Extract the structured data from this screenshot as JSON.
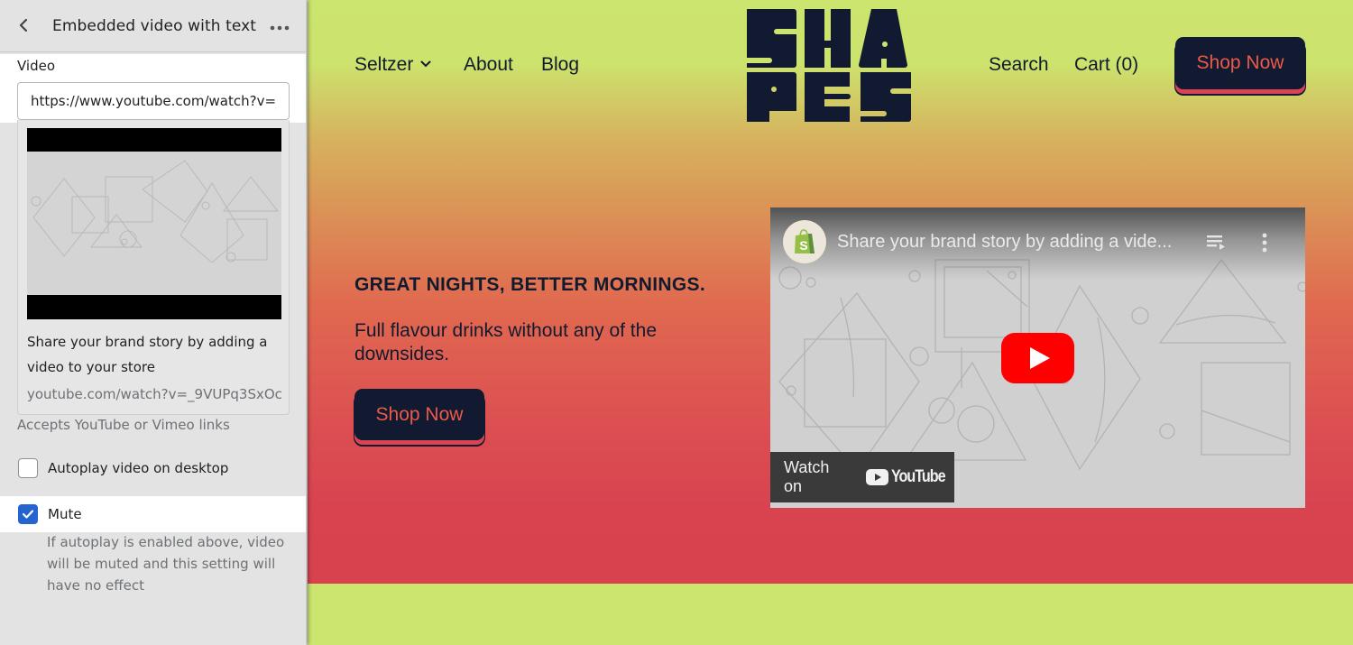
{
  "sidebar": {
    "title": "Embedded video with text",
    "back_icon": "chevron-left-icon",
    "more_icon": "ellipsis-icon",
    "video_field": {
      "label": "Video",
      "value": "https://www.youtube.com/watch?v=_9VUPq3SxOc",
      "display_value": "https://www.youtube.com/watch?v=_"
    },
    "preview": {
      "description": "Share your brand story by adding a video to your store",
      "url": "youtube.com/watch?v=_9VUPq3SxOc"
    },
    "help_text": "Accepts YouTube or Vimeo links",
    "autoplay": {
      "label": "Autoplay video on desktop",
      "checked": false
    },
    "mute": {
      "label": "Mute",
      "checked": true,
      "help": "If autoplay is enabled above, video will be muted and this setting will have no effect"
    }
  },
  "store": {
    "logo_text": "SHAPES",
    "nav": {
      "seltzer": "Seltzer",
      "about": "About",
      "blog": "Blog",
      "search": "Search",
      "cart": "Cart (0)"
    },
    "header_cta": "Shop Now",
    "hero": {
      "heading": "GREAT NIGHTS, BETTER MORNINGS.",
      "subheading": "Full flavour drinks without any of the downsides.",
      "cta": "Shop Now"
    },
    "video": {
      "title": "Share your brand story by adding a vide...",
      "watch_on": "Watch on",
      "brand": "YouTube"
    }
  },
  "colors": {
    "brand_dark": "#111a30",
    "brand_coral": "#ec5a48",
    "brand_red": "#d94353",
    "brand_lime": "#cbe56f",
    "checkbox_blue": "#2463d0",
    "youtube_red": "#ff0000"
  }
}
